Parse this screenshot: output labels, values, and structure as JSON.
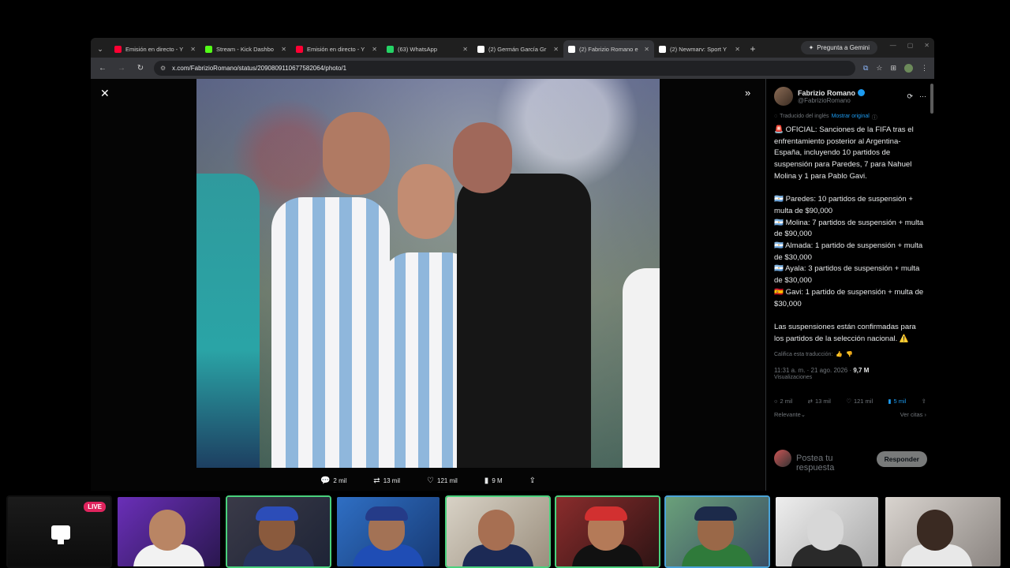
{
  "browser": {
    "tabs": [
      {
        "title": "Emisión en directo - Y",
        "icon_color": "#ff0033",
        "active": false
      },
      {
        "title": "Stream - Kick Dashbo",
        "icon_color": "#53fc18",
        "active": false
      },
      {
        "title": "Emisión en directo - Y",
        "icon_color": "#ff0033",
        "active": false
      },
      {
        "title": "(63) WhatsApp",
        "icon_color": "#25d366",
        "active": false
      },
      {
        "title": "(2) Germán García Gr",
        "icon_color": "#ffffff",
        "active": false
      },
      {
        "title": "(2) Fabrizio Romano e",
        "icon_color": "#ffffff",
        "active": true
      },
      {
        "title": "(2) Newmarv: Sport Y",
        "icon_color": "#ffffff",
        "active": false
      }
    ],
    "gemini_label": "Pregunta a Gemini",
    "url": "x.com/FabrizioRomano/status/2090809110677582064/photo/1"
  },
  "photo_actions": {
    "replies": "2 mil",
    "reposts": "13 mil",
    "likes": "121 mil",
    "views": "9 M"
  },
  "tweet": {
    "author_name": "Fabrizio Romano",
    "handle": "@FabrizioRomano",
    "translated_label": "Traducido del inglés",
    "show_original": "Mostrar original",
    "text": "🚨 OFICIAL: Sanciones de la FIFA tras el enfrentamiento posterior al Argentina-España, incluyendo 10 partidos de suspensión para Paredes, 7 para Nahuel Molina y 1 para Pablo Gavi.\n\n🇦🇷 Paredes: 10 partidos de suspensión + multa de $90,000\n🇦🇷 Molina: 7 partidos de suspensión + multa de $90,000\n🇦🇷 Almada: 1 partido de suspensión + multa de $30,000\n🇦🇷 Ayala: 3 partidos de suspensión + multa de $30,000\n🇪🇸 Gavi: 1 partido de suspensión + multa de $30,000\n\nLas suspensiones están confirmadas para los partidos de la selección nacional. ⚠️",
    "rate_label": "Califica esta traducción:",
    "time": "11:31 a. m. · 21 ago. 2026 · ",
    "views_count": "9,7 M",
    "views_label": "Visualizaciones",
    "stats": {
      "replies": "2 mil",
      "reposts": "13 mil",
      "likes": "121 mil",
      "bookmarks": "5 mil"
    },
    "sort_label": "Relevante",
    "quotes_label": "Ver citas",
    "composer_placeholder": "Postea tu respuesta",
    "reply_button": "Responder"
  },
  "stream": {
    "live_label": "LIVE"
  },
  "colors": {
    "accent_blue": "#1d9bf0",
    "live_red": "#e0245e",
    "cam_border": "#49d17c"
  }
}
